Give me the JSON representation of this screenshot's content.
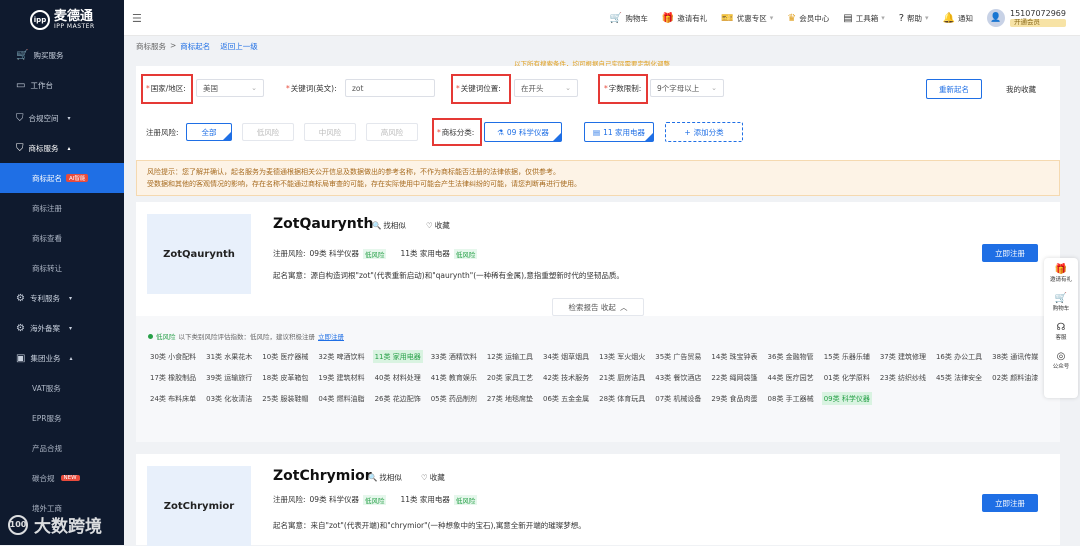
{
  "brand": {
    "cn": "麦德通",
    "en": "IPP MASTER",
    "mark": "ipp"
  },
  "sidebar": {
    "items": [
      {
        "label": "购买服务",
        "icon": "cart-icon"
      },
      {
        "label": "工作台",
        "icon": "monitor-icon"
      },
      {
        "label": "合规空间",
        "icon": "shield-icon"
      },
      {
        "label": "商标服务",
        "icon": "shield-icon"
      },
      {
        "label": "专利服务",
        "icon": "gear-icon"
      },
      {
        "label": "海外备案",
        "icon": "gear-icon"
      },
      {
        "label": "集团业务",
        "icon": "briefcase-icon"
      }
    ],
    "trademark_sub": [
      "商标起名",
      "商标注册",
      "商标查看",
      "商标转让"
    ],
    "ai_badge": "AI智能",
    "group_sub": [
      "VAT服务",
      "EPR服务",
      "产品合规",
      "碳合规",
      "境外工商"
    ],
    "new_badge": "NEW"
  },
  "watermark": {
    "text": "大数跨境",
    "mark": "100"
  },
  "topbar": {
    "links": [
      "购物车",
      "邀请有礼",
      "优惠专区",
      "会员中心",
      "工具箱",
      "帮助",
      "通知"
    ],
    "phone": "15107072969",
    "member": "开通会员"
  },
  "breadcrumb": {
    "root": "商标服务",
    "current": "商标起名",
    "back": "返回上一级"
  },
  "hint": "以下所有搜索条件，均可根据自己实际需要定制化调整",
  "filter": {
    "country_label": "国家/地区:",
    "country_value": "美国",
    "keyword_label": "关键词(英文):",
    "keyword_value": "zot",
    "position_label": "关键词位置:",
    "position_value": "在开头",
    "length_label": "字数限制:",
    "length_value": "9个字母以上",
    "rename_button": "重新起名",
    "favorites": "我的收藏",
    "risk_label": "注册风险:",
    "risk_options": [
      "全部",
      "低风险",
      "中风险",
      "高风险"
    ],
    "class_label": "商标分类:",
    "class_options": [
      "09 科学仪器",
      "11 家用电器"
    ],
    "add_class": "添加分类"
  },
  "warning": {
    "line1": "风险提示：您了解并确认，起名服务为麦德通根据相关公开信息及数据做出的参考名称，不作为商标能否注册的法律依据，仅供参考。",
    "line2": "受数据和其他的客观情况的影响，存在名称不能通过商标局审查的可能，存在实际使用中可能会产生法律纠纷的可能，请您判断再进行使用。"
  },
  "cards": [
    {
      "name": "ZotQaurynth",
      "similar": "找相似",
      "favorite": "收藏",
      "risk_prefix": "注册风险:",
      "cls1": "09类 科学仪器",
      "cls2": "11类 家用电器",
      "risk": "低风险",
      "meaning": "起名寓意：源自构造词根\"zot\"(代表重新启动)和\"qaurynth\"(一种稀有金属),意指重塑新时代的坚韧品质。",
      "register": "立即注册",
      "report_toggle": "检索报告 收起"
    },
    {
      "name": "ZotChrymior",
      "similar": "找相似",
      "favorite": "收藏",
      "risk_prefix": "注册风险:",
      "cls1": "09类 科学仪器",
      "cls2": "11类 家用电器",
      "risk": "低风险",
      "meaning": "起名寓意：来自\"zot\"(代表开端)和\"chrymior\"(一种想象中的宝石),寓意全新开端的璀璨梦想。",
      "register": "立即注册"
    }
  ],
  "detail": {
    "legend_label": "低风险",
    "legend_text": "以下类别风险评估指数：低风险，建议积极注册",
    "legend_link": "立即注册",
    "classes": [
      {
        "t": "30类 小食配料",
        "hl": false
      },
      {
        "t": "31类 水果花木",
        "hl": false
      },
      {
        "t": "10类 医疗器械",
        "hl": false
      },
      {
        "t": "32类 啤酒饮料",
        "hl": false
      },
      {
        "t": "11类 家用电器",
        "hl": true
      },
      {
        "t": "33类 酒精饮料",
        "hl": false
      },
      {
        "t": "12类 运输工具",
        "hl": false
      },
      {
        "t": "34类 烟草烟具",
        "hl": false
      },
      {
        "t": "13类 军火烟火",
        "hl": false
      },
      {
        "t": "35类 广告贸易",
        "hl": false
      },
      {
        "t": "14类 珠宝钟表",
        "hl": false
      },
      {
        "t": "36类 金融物管",
        "hl": false
      },
      {
        "t": "15类 乐器乐辅",
        "hl": false
      },
      {
        "t": "37类 建筑修理",
        "hl": false
      },
      {
        "t": "16类 办公工具",
        "hl": false
      },
      {
        "t": "38类 通讯传媒",
        "hl": false
      },
      {
        "t": "17类 橡胶制品",
        "hl": false
      },
      {
        "t": "39类 运输旅行",
        "hl": false
      },
      {
        "t": "18类 皮革箱包",
        "hl": false
      },
      {
        "t": "19类 建筑材料",
        "hl": false
      },
      {
        "t": "40类 材料处理",
        "hl": false
      },
      {
        "t": "41类 教育娱乐",
        "hl": false
      },
      {
        "t": "20类 家具工艺",
        "hl": false
      },
      {
        "t": "42类 技术服务",
        "hl": false
      },
      {
        "t": "21类 厨房洁具",
        "hl": false
      },
      {
        "t": "43类 餐饮酒店",
        "hl": false
      },
      {
        "t": "22类 绳网袋篷",
        "hl": false
      },
      {
        "t": "44类 医疗园艺",
        "hl": false
      },
      {
        "t": "01类 化学原料",
        "hl": false
      },
      {
        "t": "23类 纺织纱线",
        "hl": false
      },
      {
        "t": "45类 法律安全",
        "hl": false
      },
      {
        "t": "02类 颜料油漆",
        "hl": false
      },
      {
        "t": "24类 布料床单",
        "hl": false
      },
      {
        "t": "03类 化妆清洁",
        "hl": false
      },
      {
        "t": "25类 服装鞋帽",
        "hl": false
      },
      {
        "t": "04类 燃料油脂",
        "hl": false
      },
      {
        "t": "26类 花边配饰",
        "hl": false
      },
      {
        "t": "05类 药品制剂",
        "hl": false
      },
      {
        "t": "27类 地毯席垫",
        "hl": false
      },
      {
        "t": "06类 五金金属",
        "hl": false
      },
      {
        "t": "28类 体育玩具",
        "hl": false
      },
      {
        "t": "07类 机械设备",
        "hl": false
      },
      {
        "t": "29类 食品肉蛋",
        "hl": false
      },
      {
        "t": "08类 手工器械",
        "hl": false
      },
      {
        "t": "09类 科学仪器",
        "hl": true
      }
    ]
  },
  "float": [
    "邀请有礼",
    "购物车",
    "客服",
    "公众号"
  ]
}
